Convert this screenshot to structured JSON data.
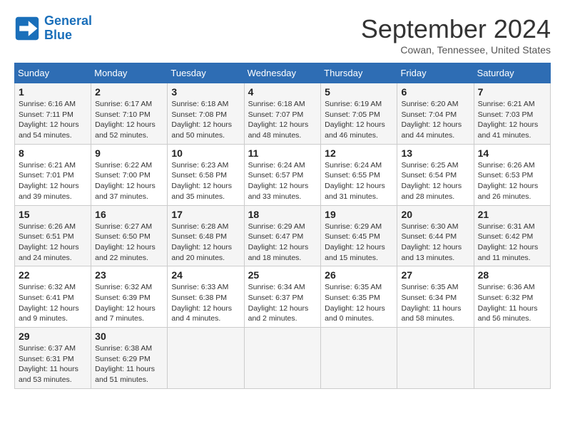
{
  "logo": {
    "line1": "General",
    "line2": "Blue"
  },
  "title": "September 2024",
  "location": "Cowan, Tennessee, United States",
  "days_of_week": [
    "Sunday",
    "Monday",
    "Tuesday",
    "Wednesday",
    "Thursday",
    "Friday",
    "Saturday"
  ],
  "weeks": [
    [
      {
        "day": "1",
        "info": "Sunrise: 6:16 AM\nSunset: 7:11 PM\nDaylight: 12 hours\nand 54 minutes."
      },
      {
        "day": "2",
        "info": "Sunrise: 6:17 AM\nSunset: 7:10 PM\nDaylight: 12 hours\nand 52 minutes."
      },
      {
        "day": "3",
        "info": "Sunrise: 6:18 AM\nSunset: 7:08 PM\nDaylight: 12 hours\nand 50 minutes."
      },
      {
        "day": "4",
        "info": "Sunrise: 6:18 AM\nSunset: 7:07 PM\nDaylight: 12 hours\nand 48 minutes."
      },
      {
        "day": "5",
        "info": "Sunrise: 6:19 AM\nSunset: 7:05 PM\nDaylight: 12 hours\nand 46 minutes."
      },
      {
        "day": "6",
        "info": "Sunrise: 6:20 AM\nSunset: 7:04 PM\nDaylight: 12 hours\nand 44 minutes."
      },
      {
        "day": "7",
        "info": "Sunrise: 6:21 AM\nSunset: 7:03 PM\nDaylight: 12 hours\nand 41 minutes."
      }
    ],
    [
      {
        "day": "8",
        "info": "Sunrise: 6:21 AM\nSunset: 7:01 PM\nDaylight: 12 hours\nand 39 minutes."
      },
      {
        "day": "9",
        "info": "Sunrise: 6:22 AM\nSunset: 7:00 PM\nDaylight: 12 hours\nand 37 minutes."
      },
      {
        "day": "10",
        "info": "Sunrise: 6:23 AM\nSunset: 6:58 PM\nDaylight: 12 hours\nand 35 minutes."
      },
      {
        "day": "11",
        "info": "Sunrise: 6:24 AM\nSunset: 6:57 PM\nDaylight: 12 hours\nand 33 minutes."
      },
      {
        "day": "12",
        "info": "Sunrise: 6:24 AM\nSunset: 6:55 PM\nDaylight: 12 hours\nand 31 minutes."
      },
      {
        "day": "13",
        "info": "Sunrise: 6:25 AM\nSunset: 6:54 PM\nDaylight: 12 hours\nand 28 minutes."
      },
      {
        "day": "14",
        "info": "Sunrise: 6:26 AM\nSunset: 6:53 PM\nDaylight: 12 hours\nand 26 minutes."
      }
    ],
    [
      {
        "day": "15",
        "info": "Sunrise: 6:26 AM\nSunset: 6:51 PM\nDaylight: 12 hours\nand 24 minutes."
      },
      {
        "day": "16",
        "info": "Sunrise: 6:27 AM\nSunset: 6:50 PM\nDaylight: 12 hours\nand 22 minutes."
      },
      {
        "day": "17",
        "info": "Sunrise: 6:28 AM\nSunset: 6:48 PM\nDaylight: 12 hours\nand 20 minutes."
      },
      {
        "day": "18",
        "info": "Sunrise: 6:29 AM\nSunset: 6:47 PM\nDaylight: 12 hours\nand 18 minutes."
      },
      {
        "day": "19",
        "info": "Sunrise: 6:29 AM\nSunset: 6:45 PM\nDaylight: 12 hours\nand 15 minutes."
      },
      {
        "day": "20",
        "info": "Sunrise: 6:30 AM\nSunset: 6:44 PM\nDaylight: 12 hours\nand 13 minutes."
      },
      {
        "day": "21",
        "info": "Sunrise: 6:31 AM\nSunset: 6:42 PM\nDaylight: 12 hours\nand 11 minutes."
      }
    ],
    [
      {
        "day": "22",
        "info": "Sunrise: 6:32 AM\nSunset: 6:41 PM\nDaylight: 12 hours\nand 9 minutes."
      },
      {
        "day": "23",
        "info": "Sunrise: 6:32 AM\nSunset: 6:39 PM\nDaylight: 12 hours\nand 7 minutes."
      },
      {
        "day": "24",
        "info": "Sunrise: 6:33 AM\nSunset: 6:38 PM\nDaylight: 12 hours\nand 4 minutes."
      },
      {
        "day": "25",
        "info": "Sunrise: 6:34 AM\nSunset: 6:37 PM\nDaylight: 12 hours\nand 2 minutes."
      },
      {
        "day": "26",
        "info": "Sunrise: 6:35 AM\nSunset: 6:35 PM\nDaylight: 12 hours\nand 0 minutes."
      },
      {
        "day": "27",
        "info": "Sunrise: 6:35 AM\nSunset: 6:34 PM\nDaylight: 11 hours\nand 58 minutes."
      },
      {
        "day": "28",
        "info": "Sunrise: 6:36 AM\nSunset: 6:32 PM\nDaylight: 11 hours\nand 56 minutes."
      }
    ],
    [
      {
        "day": "29",
        "info": "Sunrise: 6:37 AM\nSunset: 6:31 PM\nDaylight: 11 hours\nand 53 minutes."
      },
      {
        "day": "30",
        "info": "Sunrise: 6:38 AM\nSunset: 6:29 PM\nDaylight: 11 hours\nand 51 minutes."
      },
      {
        "day": "",
        "info": ""
      },
      {
        "day": "",
        "info": ""
      },
      {
        "day": "",
        "info": ""
      },
      {
        "day": "",
        "info": ""
      },
      {
        "day": "",
        "info": ""
      }
    ]
  ]
}
